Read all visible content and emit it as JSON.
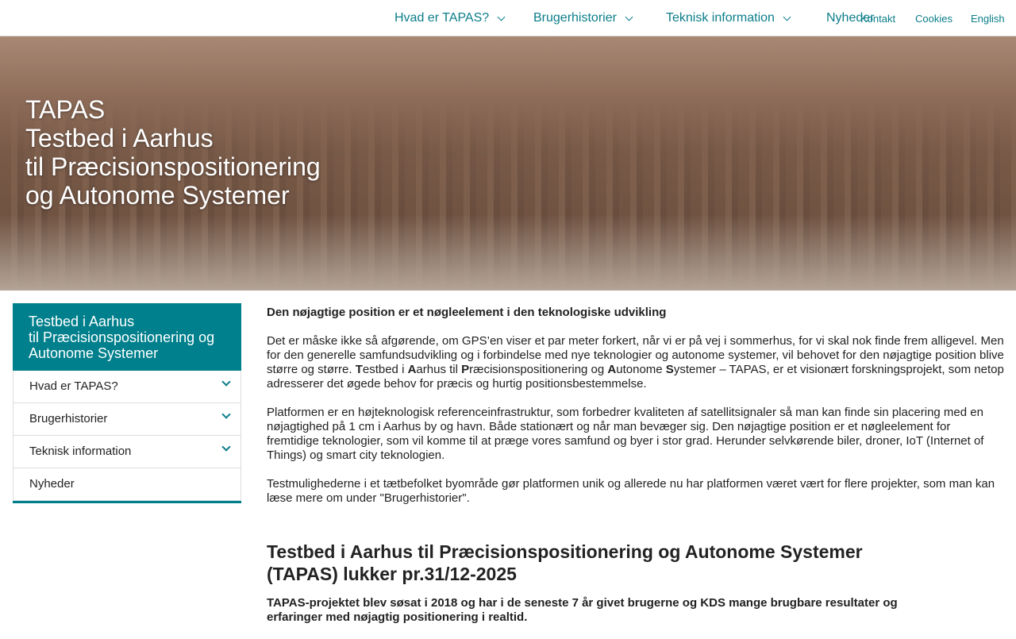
{
  "nav": {
    "items": [
      {
        "label": "Hvad er TAPAS?",
        "dropdown": true
      },
      {
        "label": "Brugerhistorier",
        "dropdown": true
      },
      {
        "label": "Teknisk information",
        "dropdown": true
      },
      {
        "label": "Nyheder",
        "dropdown": false
      }
    ],
    "utility": [
      "Kontakt",
      "Cookies",
      "English"
    ]
  },
  "hero": {
    "lines": [
      "TAPAS",
      "Testbed i Aarhus",
      "til Præcisionspositionering",
      "og Autonome Systemer"
    ]
  },
  "sidebar": {
    "title_lines": [
      "Testbed i Aarhus",
      "til Præcisionspositionering og",
      "Autonome Systemer"
    ],
    "items": [
      {
        "label": "Hvad er TAPAS?"
      },
      {
        "label": "Brugerhistorier"
      },
      {
        "label": "Teknisk information"
      },
      {
        "label": "Nyheder"
      }
    ]
  },
  "main": {
    "lead": "Den nøjagtige position er et nøgleelement i den teknologiske udvikling",
    "p1": [
      {
        "t": "Det er måske ikke så afgørende, om GPS’en viser et par meter forkert, når vi er på vej i sommerhus, for vi skal nok finde frem alligevel. Men for den generelle samfundsudvikling og i forbindelse med nye teknologier og autonome systemer, vil behovet for den nøjagtige position blive større og større. "
      },
      {
        "t": "T",
        "b": true
      },
      {
        "t": "estbed i "
      },
      {
        "t": "A",
        "b": true
      },
      {
        "t": "arhus til "
      },
      {
        "t": "P",
        "b": true
      },
      {
        "t": "ræcisionspositionering og "
      },
      {
        "t": "A",
        "b": true
      },
      {
        "t": "utonome "
      },
      {
        "t": "S",
        "b": true
      },
      {
        "t": "ystemer – TAPAS, er et visionært forskningsprojekt, som netop adresserer det øgede behov for præcis og hurtig positionsbestemmelse."
      }
    ],
    "p2": "Platformen er en højteknologisk referenceinfrastruktur, som forbedrer kvaliteten af satellitsignaler så man kan finde sin placering med en nøjagtighed på 1 cm i Aarhus by og havn. Både stationært og når man bevæger sig. Den nøjagtige position er et nøgleelement for fremtidige teknologier, som vil komme til at præge vores samfund og byer i stor grad. Herunder selvkørende biler, droner, IoT (Internet of Things) og smart city teknologien.",
    "p3": "Testmulighederne i et tætbefolket byområde gør platformen unik og allerede nu har platformen været vært for flere projekter, som man kan læse mere om under \"Brugerhistorier\".",
    "heading": "Testbed i Aarhus til Præcisionspositionering og Autonome Systemer (TAPAS) lukker pr.31/12-2025",
    "p4": " TAPAS-projektet blev søsat i 2018 og har i de seneste 7 år givet brugerne og KDS mange brugbare resultater og erfaringer med nøjagtig positionering i realtid."
  },
  "colors": {
    "accent": "#00808c",
    "link": "#0b7d8a"
  }
}
